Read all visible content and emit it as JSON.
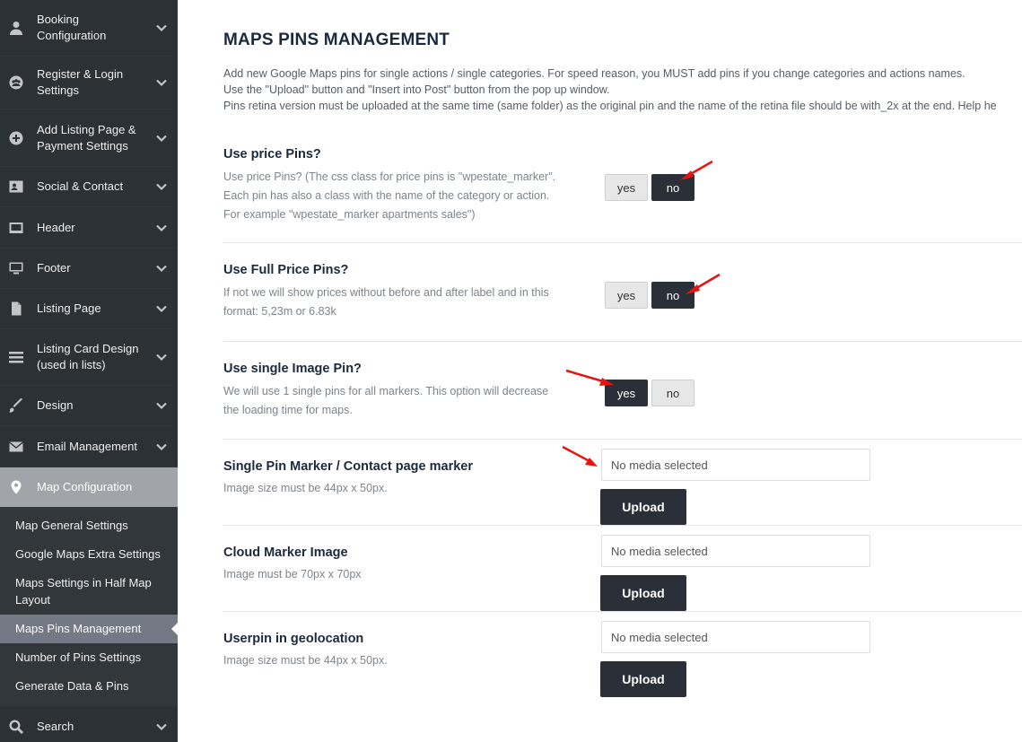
{
  "sidebar": {
    "items": [
      {
        "label": "Booking Configuration",
        "icon": "user-icon"
      },
      {
        "label": "Register & Login Settings",
        "icon": "users-icon"
      },
      {
        "label": "Add Listing Page & Payment Settings",
        "icon": "plus-circle-icon"
      },
      {
        "label": "Social & Contact",
        "icon": "contact-card-icon"
      },
      {
        "label": "Header",
        "icon": "window-icon"
      },
      {
        "label": "Footer",
        "icon": "monitor-icon"
      },
      {
        "label": "Listing Page",
        "icon": "document-icon"
      },
      {
        "label": "Listing Card Design (used in lists)",
        "icon": "list-icon"
      },
      {
        "label": "Design",
        "icon": "brush-icon"
      },
      {
        "label": "Email Management",
        "icon": "envelope-icon"
      },
      {
        "label": "Map Configuration",
        "icon": "map-pin-icon"
      }
    ],
    "submenu": [
      "Map General Settings",
      "Google Maps Extra Settings",
      "Maps Settings in Half Map Layout",
      "Maps Pins Management",
      "Number of Pins Settings",
      "Generate Data & Pins"
    ],
    "search": {
      "label": "Search",
      "icon": "search-icon"
    }
  },
  "main": {
    "title": "MAPS PINS MANAGEMENT",
    "intro": [
      "Add new Google Maps pins for single actions / single categories. For speed reason, you MUST add pins if you change categories and actions names.",
      "Use the \"Upload\" button and \"Insert into Post\" button from the pop up window.",
      "Pins retina version must be uploaded at the same time (same folder) as the original pin and the name of the retina file should be with_2x at the end. Help he"
    ],
    "options": [
      {
        "title": "Use price Pins?",
        "desc": [
          "Use price Pins? (The css class for price pins is \"wpestate_marker\".",
          "Each pin has also a class with the name of the category or action.",
          "For example \"wpestate_marker apartments sales\")"
        ],
        "yes": "yes",
        "no": "no",
        "selected": "no"
      },
      {
        "title": "Use Full Price Pins?",
        "desc": [
          "If not we will show prices without before and after label and in this",
          "format: 5,23m or 6.83k"
        ],
        "yes": "yes",
        "no": "no",
        "selected": "no"
      },
      {
        "title": "Use single Image Pin?",
        "desc": [
          "We will use 1 single pins for all markers. This option will decrease",
          "the loading time for maps."
        ],
        "yes": "yes",
        "no": "no",
        "selected": "yes"
      }
    ],
    "media": [
      {
        "title": "Single Pin Marker / Contact page marker",
        "desc": "Image size must be 44px x 50px.",
        "value": "No media selected",
        "button": "Upload"
      },
      {
        "title": "Cloud Marker Image",
        "desc": "Image must be 70px x 70px",
        "value": "No media selected",
        "button": "Upload"
      },
      {
        "title": "Userpin in geolocation",
        "desc": "Image size must be 44px x 50px.",
        "value": "No media selected",
        "button": "Upload"
      }
    ]
  },
  "colors": {
    "sidebar_bg": "#23282d",
    "sidebar_active": "#a1a5a9",
    "submenu_current": "#737985",
    "toggle_on": "#2a2f38",
    "annotation_arrow": "#e8140f"
  }
}
